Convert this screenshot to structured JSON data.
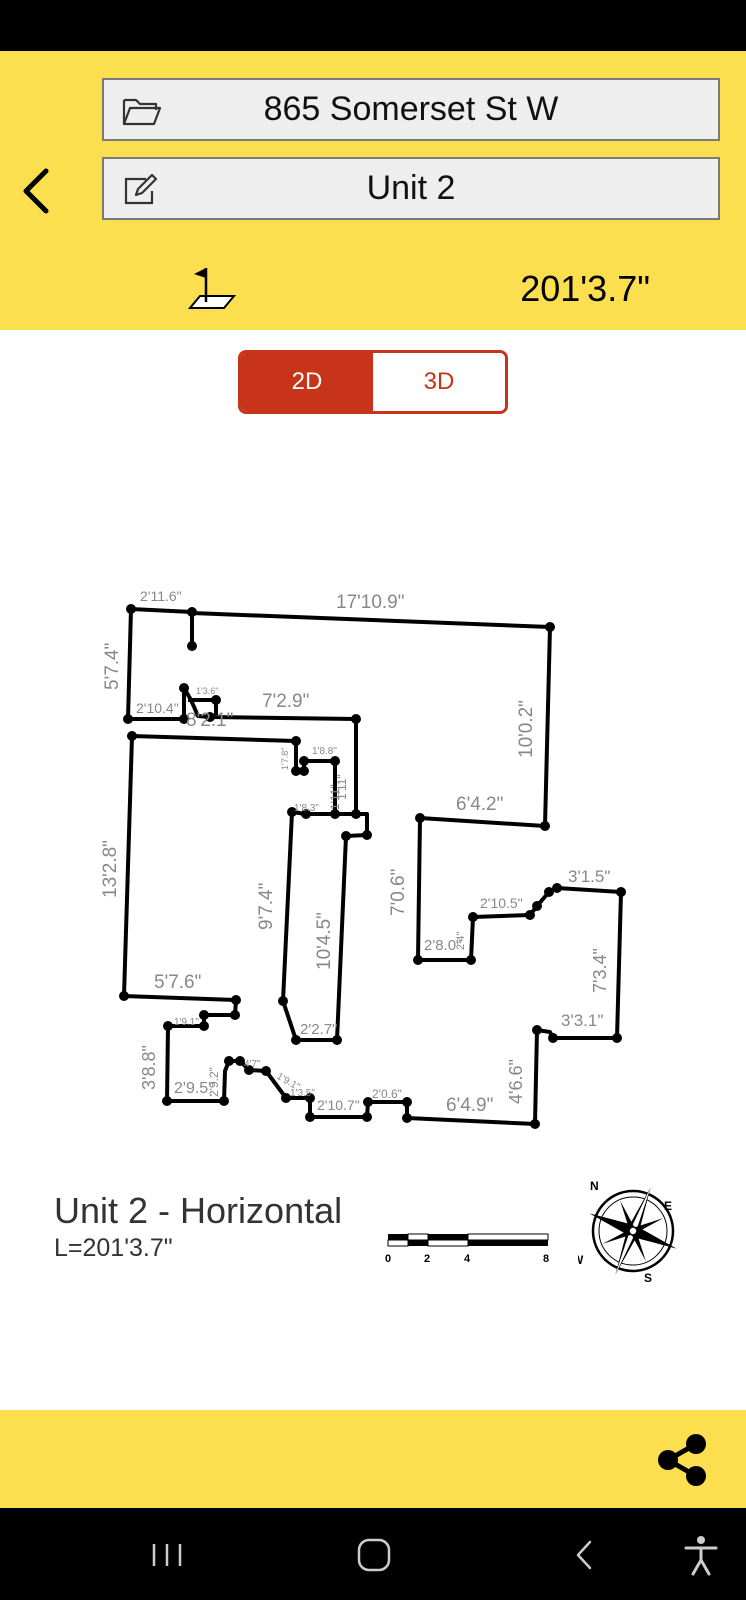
{
  "header": {
    "address": "865 Somerset St W",
    "unit": "Unit 2",
    "total_length": "201'3.7\""
  },
  "view_toggle": {
    "options": [
      "2D",
      "3D"
    ],
    "selected": "2D"
  },
  "plan": {
    "main_labels": [
      "2'11.6\"",
      "17'10.9\"",
      "5'7.4\"",
      "10'0.2\"",
      "7'2.9\"",
      "2'10.4\"",
      "8'2.1\"",
      "13'2.8\"",
      "6'4.2\"",
      "9'7.4\"",
      "10'4.5\"",
      "7'0.6\"",
      "3'1.5\"",
      "2'10.5\"",
      "2'8.0\"",
      "7'3.4\"",
      "5'7.6\"",
      "3'3.1\"",
      "2'2.7\"",
      "3'8.8\"",
      "4'6.6\"",
      "2'9.5\"",
      "6'4.9\"",
      "2'10.7\"",
      "2'0.6\""
    ],
    "small_labels": [
      "1'8.8\"",
      "1'9.1\"",
      "4'7\"",
      "1'9.1\"",
      "1'3.5\"",
      "1'11\"",
      "1'3.6\"",
      "1'7.8\"",
      "1'8.3\"",
      "2'4\"",
      "2'9.2\"",
      "1'11\""
    ]
  },
  "caption": {
    "title": "Unit 2 - Horizontal",
    "length": "L=201'3.7\""
  },
  "scale": {
    "ticks": [
      "0",
      "2",
      "4",
      "8"
    ]
  },
  "compass": {
    "labels": [
      "N",
      "E",
      "W",
      "S"
    ]
  },
  "colors": {
    "header_bg": "#FCDF4E",
    "accent": "#C7341A"
  }
}
